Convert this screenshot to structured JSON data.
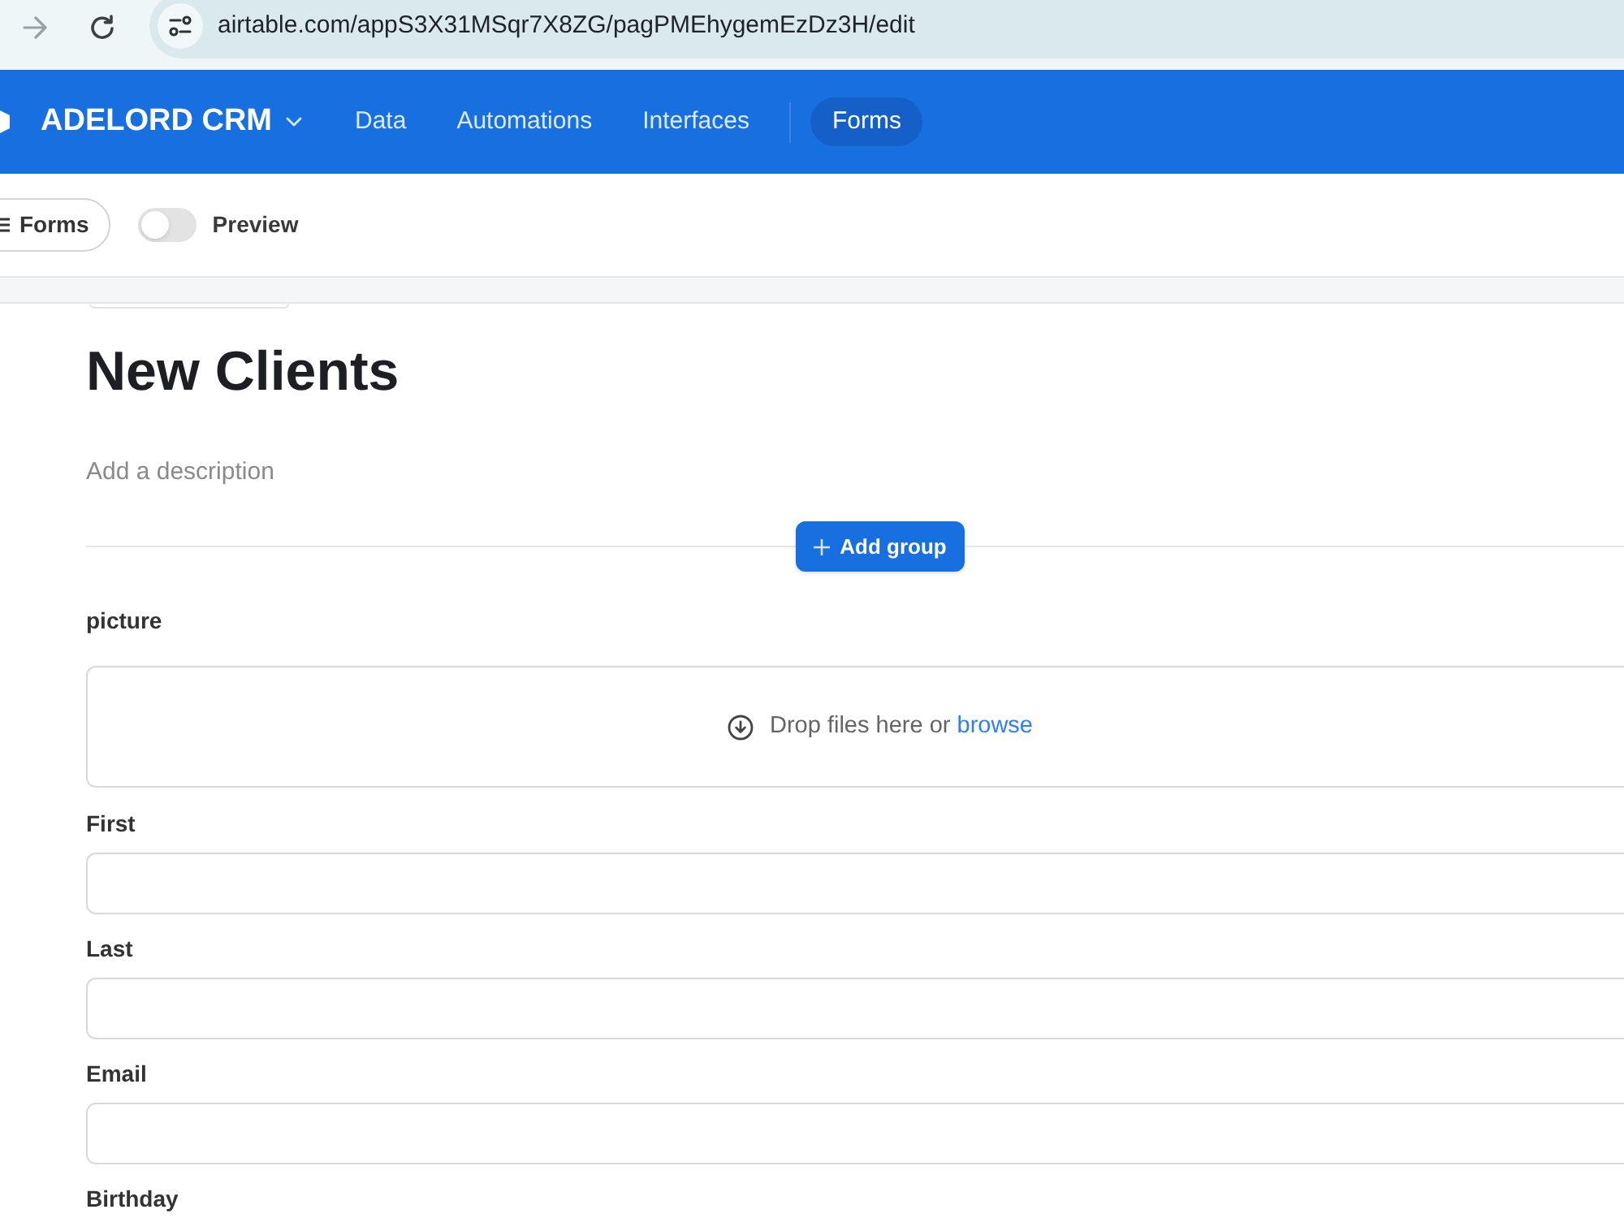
{
  "browser": {
    "url": "airtable.com/appS3X31MSqr7X8ZG/pagPMEhygemEzDz3H/edit"
  },
  "app_bar": {
    "base_name": "ADELORD CRM",
    "nav": [
      {
        "label": "Data",
        "selected": false
      },
      {
        "label": "Automations",
        "selected": false
      },
      {
        "label": "Interfaces",
        "selected": false
      },
      {
        "label": "Forms",
        "selected": true
      }
    ]
  },
  "toolbar": {
    "forms_button": "Forms",
    "preview": {
      "label": "Preview",
      "on": false
    }
  },
  "form": {
    "title": "New Clients",
    "description": {
      "placeholder": "Add a description"
    },
    "add_group_button": "Add group",
    "fields": [
      {
        "kind": "attachment",
        "label": "picture",
        "drop_text": "Drop files here or",
        "link": "browse"
      },
      {
        "kind": "text",
        "label": "First"
      },
      {
        "kind": "text",
        "label": "Last"
      },
      {
        "kind": "text",
        "label": "Email"
      },
      {
        "kind": "text",
        "label": "Birthday"
      }
    ]
  }
}
